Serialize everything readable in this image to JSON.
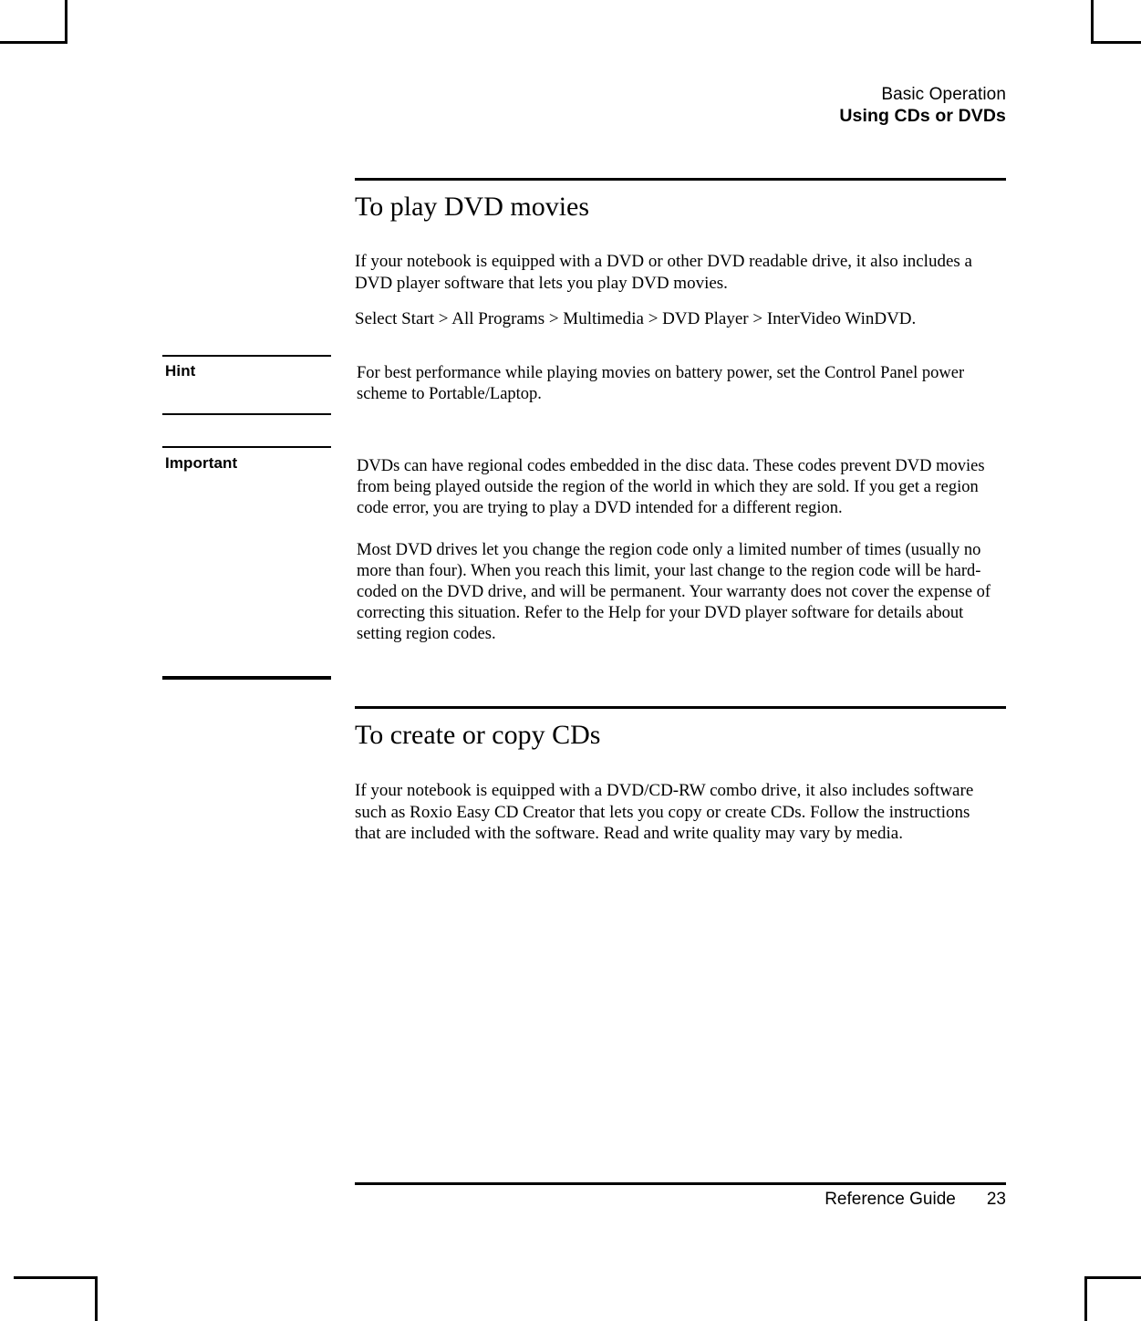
{
  "header": {
    "line1": "Basic Operation",
    "line2": "Using CDs or DVDs"
  },
  "sections": [
    {
      "heading": "To play DVD movies",
      "paragraphs": [
        "If your notebook is equipped with a DVD or other DVD readable drive, it also includes a DVD player software that lets you play DVD movies.",
        "Select Start > All Programs > Multimedia > DVD Player > InterVideo WinDVD."
      ]
    },
    {
      "heading": "To create or copy CDs",
      "paragraphs": [
        "If your notebook is equipped with a DVD/CD-RW combo drive, it also includes software such as Roxio Easy CD Creator that lets you copy or create CDs. Follow the instructions that are included with the software. Read and write quality may vary by media."
      ]
    }
  ],
  "notes": [
    {
      "label": "Hint",
      "paragraphs": [
        "For best performance while playing movies on battery power, set the Control Panel power scheme to Portable/Laptop."
      ]
    },
    {
      "label": "Important",
      "paragraphs": [
        "DVDs can have regional codes embedded in the disc data. These codes prevent DVD movies from being played outside the region of the world in which they are sold. If you get a region code error, you are trying to play a DVD intended for a different region.",
        "Most DVD drives let you change the region code only a limited number of times (usually no more than four). When you reach this limit, your last change to the region code will be hard-coded on the DVD drive, and will be permanent. Your warranty does not cover the expense of correcting this situation. Refer to the Help for your DVD player software for details about setting region codes."
      ]
    }
  ],
  "footer": {
    "guide_title": "Reference Guide",
    "page_number": "23"
  },
  "colors": {
    "text": "#000000",
    "rule": "#000000",
    "page_background": "#ffffff"
  }
}
